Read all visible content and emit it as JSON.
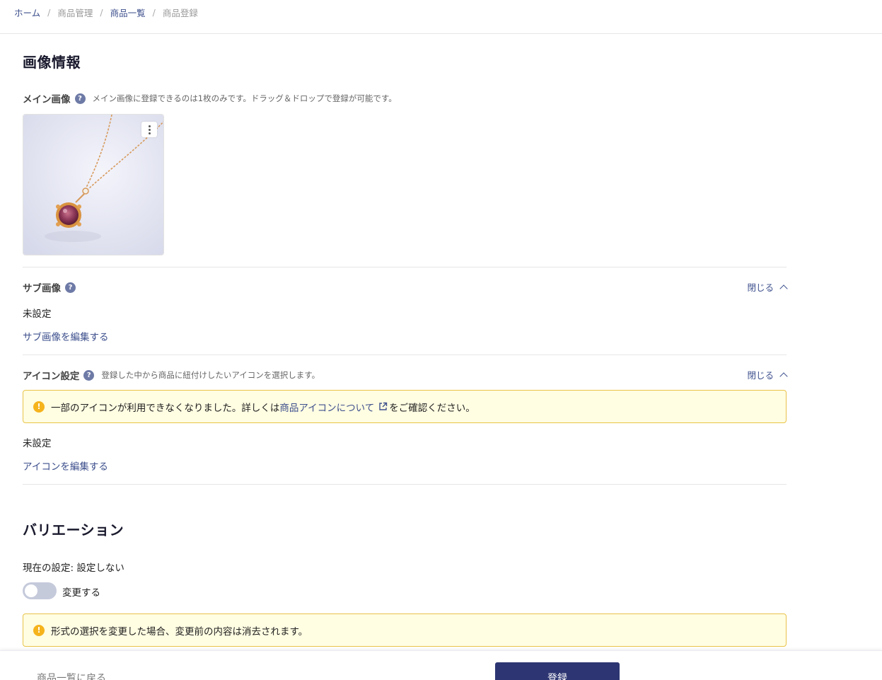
{
  "breadcrumb": {
    "home": "ホーム",
    "separator": "/",
    "product_mgmt": "商品管理",
    "product_list": "商品一覧",
    "current": "商品登録"
  },
  "image_section": {
    "title": "画像情報",
    "main_image": {
      "label": "メイン画像",
      "help": "?",
      "description": "メイン画像に登録できるのは1枚のみです。ドラッグ＆ドロップで登録が可能です。"
    },
    "sub_image": {
      "label": "サブ画像",
      "help": "?",
      "collapse_label": "閉じる",
      "value": "未設定",
      "edit_link": "サブ画像を編集する"
    },
    "icon_setting": {
      "label": "アイコン設定",
      "help": "?",
      "description": "登録した中から商品に紐付けしたいアイコンを選択します。",
      "collapse_label": "閉じる",
      "notice_prefix": "一部のアイコンが利用できなくなりました。詳しくは",
      "notice_link": "商品アイコンについて",
      "notice_suffix": "をご確認ください。",
      "value": "未設定",
      "edit_link": "アイコンを編集する"
    }
  },
  "variation_section": {
    "title": "バリエーション",
    "current_setting": "現在の設定: 設定しない",
    "toggle_label": "変更する",
    "toggle_on": false,
    "notice": "形式の選択を変更した場合、変更前の内容は消去されます。"
  },
  "footer": {
    "back": "商品一覧に戻る",
    "submit": "登録"
  },
  "colors": {
    "accent": "#2d3672",
    "link": "#3d4f8c",
    "warning": "#f5b31c",
    "notice_bg": "#fffde2"
  }
}
